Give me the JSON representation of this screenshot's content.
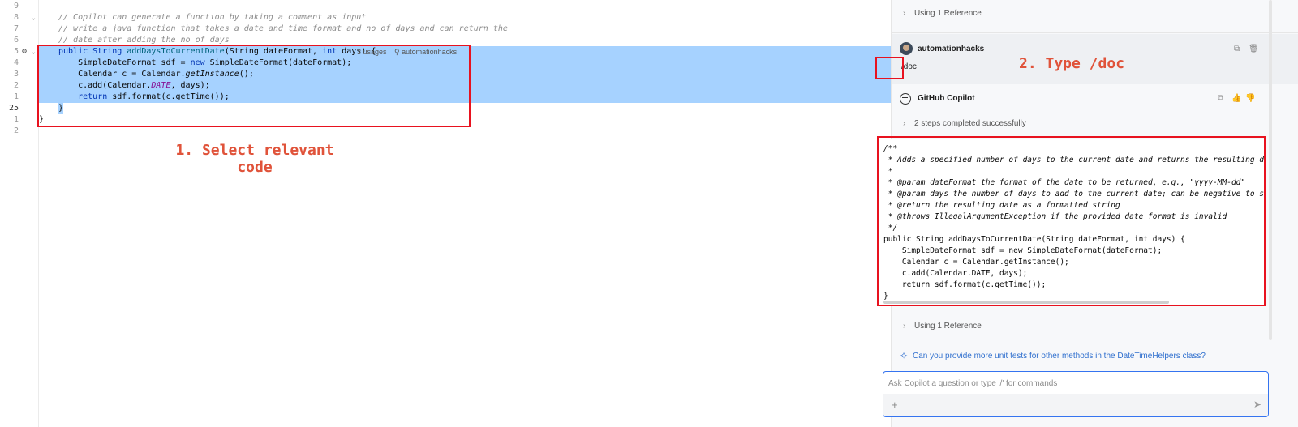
{
  "editor": {
    "lines": [
      {
        "num": "9",
        "text": ""
      },
      {
        "num": "8",
        "text": "// Copilot can generate a function by taking a comment as input"
      },
      {
        "num": "7",
        "text": "// write a java function that takes a date and time format and no of days and can return the"
      },
      {
        "num": "6",
        "text": "// date after adding the no of days"
      },
      {
        "num": "5",
        "text_parts": [
          "public String ",
          "addDaysToCurrentDate",
          "(String dateFormat, ",
          "int",
          " days) {"
        ]
      },
      {
        "num": "4",
        "text_parts": [
          "    SimpleDateFormat sdf = ",
          "new",
          " SimpleDateFormat(dateFormat);"
        ]
      },
      {
        "num": "3",
        "text_parts": [
          "    Calendar c = Calendar.",
          "getInstance",
          "();"
        ]
      },
      {
        "num": "2",
        "text_parts": [
          "    c.add(Calendar.",
          "DATE",
          ", days);"
        ]
      },
      {
        "num": "1",
        "text_parts": [
          "    ",
          "return",
          " sdf.format(c.getTime());"
        ]
      },
      {
        "num": "25",
        "text": "}"
      },
      {
        "num": "1",
        "text": "}"
      },
      {
        "num": "2",
        "text": ""
      }
    ],
    "usages": "3 usages",
    "author": "automationhacks",
    "annotation": "1. Select relevant code"
  },
  "chat": {
    "references_top": "Using 1 Reference",
    "user": {
      "name": "automationhacks",
      "message": "/doc"
    },
    "annotation": "2. Type /doc",
    "assistant": {
      "name": "GitHub Copilot",
      "steps": "2 steps completed successfully"
    },
    "code_lines": [
      "/**",
      " * Adds a specified number of days to the current date and returns the resulting date",
      " *",
      " * @param dateFormat the format of the date to be returned, e.g., \"yyyy-MM-dd\"",
      " * @param days the number of days to add to the current date; can be negative to subt",
      " * @return the resulting date as a formatted string",
      " * @throws IllegalArgumentException if the provided date format is invalid",
      " */",
      "public String addDaysToCurrentDate(String dateFormat, int days) {",
      "    SimpleDateFormat sdf = new SimpleDateFormat(dateFormat);",
      "    Calendar c = Calendar.getInstance();",
      "    c.add(Calendar.DATE, days);",
      "    return sdf.format(c.getTime());",
      "}"
    ],
    "references_bottom": "Using 1 Reference",
    "suggestion": "Can you provide more unit tests for other methods in the DateTimeHelpers class?",
    "input_placeholder": "Ask Copilot a question or type '/' for commands"
  },
  "colors": {
    "annotation": "#e0533a",
    "highlight_box": "#e8121f",
    "selection": "#a6d2ff",
    "link": "#2f6fce"
  },
  "icons": [
    "fold-chevron-icon",
    "run-gutter-icon",
    "avatar",
    "copy-icon",
    "trash-icon",
    "copilot-icon",
    "thumbs-up-icon",
    "thumbs-down-icon",
    "chevron-right-icon",
    "sparkle-icon",
    "plus-icon",
    "send-icon"
  ]
}
